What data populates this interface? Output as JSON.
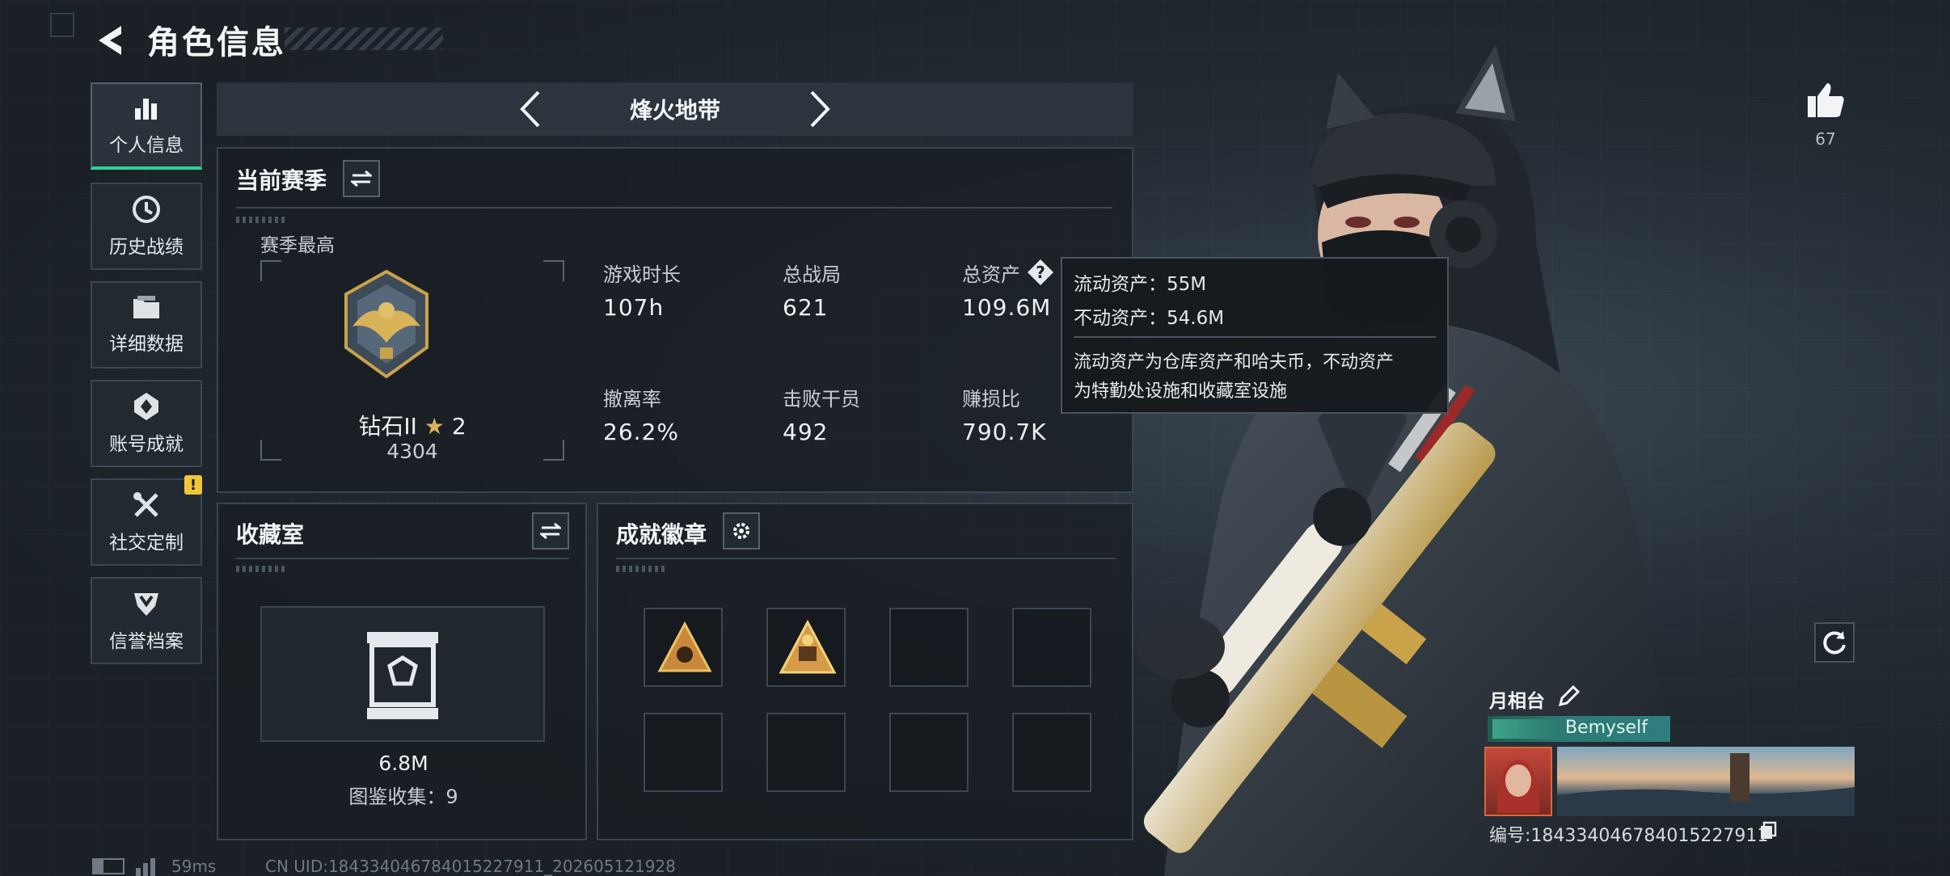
{
  "header": {
    "title": "角色信息"
  },
  "sidebar": {
    "items": [
      {
        "label": "个人信息",
        "icon": "bar-chart-icon",
        "active": true
      },
      {
        "label": "历史战绩",
        "icon": "history-clock-icon"
      },
      {
        "label": "详细数据",
        "icon": "folder-icon"
      },
      {
        "label": "账号成就",
        "icon": "achievement-icon"
      },
      {
        "label": "社交定制",
        "icon": "tools-icon",
        "badge": "!"
      },
      {
        "label": "信誉档案",
        "icon": "shield-emblem-icon"
      }
    ]
  },
  "mode_tab": {
    "name": "烽火地带"
  },
  "season": {
    "title": "当前赛季",
    "best_label": "赛季最高",
    "rank_name": "钻石II",
    "rank_stars": "2",
    "rank_score": "4304",
    "stats": [
      {
        "label": "游戏时长",
        "value": "107h"
      },
      {
        "label": "总战局",
        "value": "621"
      },
      {
        "label": "总资产",
        "value": "109.6M"
      },
      {
        "label": "撤离率",
        "value": "26.2%"
      },
      {
        "label": "击败干员",
        "value": "492"
      },
      {
        "label": "赚损比",
        "value": "790.7K"
      }
    ]
  },
  "tooltip": {
    "liquid": "流动资产：55M",
    "fixed": "不动资产：54.6M",
    "desc_line1": "流动资产为仓库资产和哈夫币，不动资产",
    "desc_line2": "为特勤处设施和收藏室设施"
  },
  "collection": {
    "title": "收藏室",
    "value": "6.8M",
    "catalog": "图鉴收集：9"
  },
  "badges": {
    "title": "成就徽章",
    "filled_slots": 2,
    "total_slots": 8
  },
  "likes": {
    "count": "67"
  },
  "profile": {
    "name": "月相台",
    "nickname": "Bemyself",
    "id_line": "编号:1843340467840152279​11"
  },
  "footer": {
    "ping": "59ms",
    "uid": "CN UID:1843340467840152279​11_202605121928"
  },
  "colors": {
    "accent_green": "#2fd39a",
    "gold": "#c9a24a",
    "warning": "#f0c53a"
  }
}
